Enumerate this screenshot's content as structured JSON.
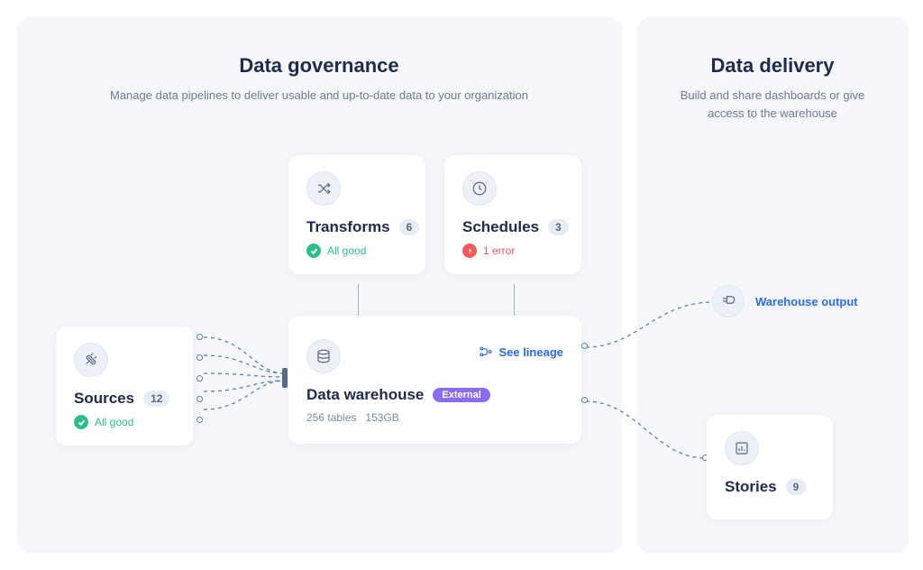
{
  "governance": {
    "title": "Data governance",
    "subtitle": "Manage data pipelines to deliver usable and up-to-date data to your organization"
  },
  "delivery": {
    "title": "Data delivery",
    "subtitle": "Build and share dashboards or give access to the warehouse"
  },
  "sources": {
    "title": "Sources",
    "count": "12",
    "status": "All good"
  },
  "transforms": {
    "title": "Transforms",
    "count": "6",
    "status": "All good"
  },
  "schedules": {
    "title": "Schedules",
    "count": "3",
    "status": "1 error"
  },
  "warehouse": {
    "title": "Data warehouse",
    "tag": "External",
    "tables": "256 tables",
    "size": "153GB",
    "lineage": "See lineage"
  },
  "output": {
    "label": "Warehouse output"
  },
  "stories": {
    "title": "Stories",
    "count": "9"
  }
}
